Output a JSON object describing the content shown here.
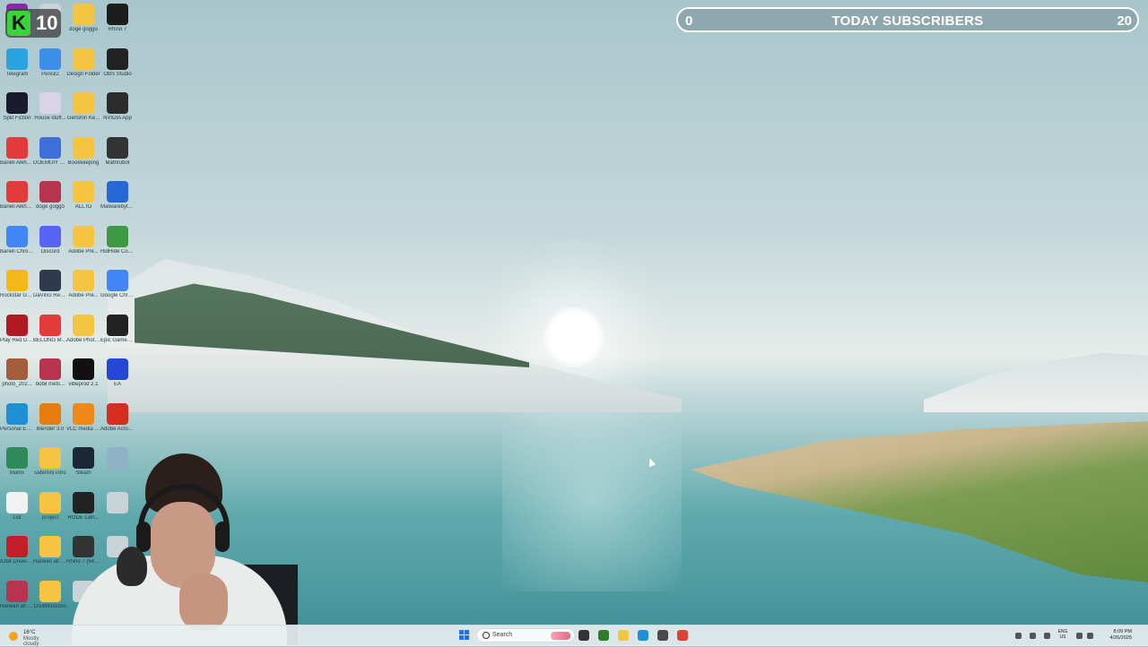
{
  "subscriber_counter": {
    "low": "0",
    "title": "TODAY SUBSCRIBERS",
    "high": "20"
  },
  "overlay_badge": {
    "letter": "K",
    "number": "10"
  },
  "desktop_icons": [
    {
      "label": "",
      "color": "#8b2aa6"
    },
    {
      "label": "",
      "color": "#c9d2d6"
    },
    {
      "label": "doge goggo",
      "color": "#f5c542"
    },
    {
      "label": "Rhino 7",
      "color": "#1d1d1d"
    },
    {
      "label": "Telegram",
      "color": "#2aa3df"
    },
    {
      "label": "Pencil2",
      "color": "#3c8ee8"
    },
    {
      "label": "Design Folder",
      "color": "#f5c542"
    },
    {
      "label": "OBS Studio",
      "color": "#222222"
    },
    {
      "label": "Split Fiction",
      "color": "#1b1b2e"
    },
    {
      "label": "House stuff...",
      "color": "#d9d3e8"
    },
    {
      "label": "Genshin Ke...",
      "color": "#f5c542"
    },
    {
      "label": "NVIDIA App",
      "color": "#2c2c2c"
    },
    {
      "label": "Baneli Alkhayri Bu...",
      "color": "#e33b3b"
    },
    {
      "label": "DOEMUIY Manager",
      "color": "#3e6fd8"
    },
    {
      "label": "Bookkeeping",
      "color": "#f5c542"
    },
    {
      "label": "Mathrubot",
      "color": "#333333"
    },
    {
      "label": "Baneli Alkhayri_Bu...",
      "color": "#e33b3b"
    },
    {
      "label": "doge goggo",
      "color": "#b8334d"
    },
    {
      "label": "ALL IO",
      "color": "#f5c542"
    },
    {
      "label": "Malwarebyt... Windows F...",
      "color": "#2567d4"
    },
    {
      "label": "Baneli Chrome",
      "color": "#4285f4"
    },
    {
      "label": "Discord",
      "color": "#5865f2"
    },
    {
      "label": "Adobe Pre...",
      "color": "#f5c542"
    },
    {
      "label": "HidHide Configurat...",
      "color": "#3d9a43"
    },
    {
      "label": "Rockstar Games ...",
      "color": "#f5b71c"
    },
    {
      "label": "DaVinci Resolve",
      "color": "#2f3b4c"
    },
    {
      "label": "Adobe Pre...",
      "color": "#f5c542"
    },
    {
      "label": "Google Chrome",
      "color": "#4285f4"
    },
    {
      "label": "Play Red Dead Rede...",
      "color": "#b01a22"
    },
    {
      "label": "BELONG M Alkhayri Bu...",
      "color": "#e33b3b"
    },
    {
      "label": "Adobe Photo...",
      "color": "#f5c542"
    },
    {
      "label": "Epic Games Launcher",
      "color": "#222222"
    },
    {
      "label": "photo_202...",
      "color": "#a35d3a"
    },
    {
      "label": "bobil mets...",
      "color": "#b8334d"
    },
    {
      "label": "vibeprod 2.1",
      "color": "#111111"
    },
    {
      "label": "EA",
      "color": "#2447d4"
    },
    {
      "label": "Personal Edge",
      "color": "#1e8fd1"
    },
    {
      "label": "Blender 3.0",
      "color": "#e87d0d"
    },
    {
      "label": "VLC media player",
      "color": "#ef8a1a"
    },
    {
      "label": "Adobe Acrobat",
      "color": "#d62d20"
    },
    {
      "label": "Matrix",
      "color": "#2e8b57"
    },
    {
      "label": "sabimini intro",
      "color": "#f5c542"
    },
    {
      "label": "Steam",
      "color": "#1b2838"
    },
    {
      "label": "",
      "color": "#8fb3c4"
    },
    {
      "label": "List",
      "color": "#f1f1f1"
    },
    {
      "label": "project",
      "color": "#f5c542"
    },
    {
      "label": "RODE Cen...",
      "color": "#222222"
    },
    {
      "label": "",
      "color": "#c9d2d6"
    },
    {
      "label": "IObit Driver Booster",
      "color": "#c41e2a"
    },
    {
      "label": "Haneen all designs ...",
      "color": "#f5c542"
    },
    {
      "label": "Rhino 7 (64-bit)",
      "color": "#333333"
    },
    {
      "label": "",
      "color": "#c9d2d6"
    },
    {
      "label": "Haneen all designs ...",
      "color": "#b8334d"
    },
    {
      "label": "DS4Windows",
      "color": "#f5c542"
    },
    {
      "label": "",
      "color": "#c9d2d6"
    },
    {
      "label": "",
      "color": "#c9d2d6"
    }
  ],
  "taskbar": {
    "weather_temp": "16°C",
    "weather_desc": "Mostly cloudy",
    "search_placeholder": "Search",
    "apps": [
      {
        "name": "task-view",
        "color": "#333333"
      },
      {
        "name": "xbox",
        "color": "#2d7d2d"
      },
      {
        "name": "file-explorer",
        "color": "#f5c542"
      },
      {
        "name": "edge",
        "color": "#1e8fd1"
      },
      {
        "name": "calculator",
        "color": "#4a4a4a"
      },
      {
        "name": "chrome",
        "color": "#db4437"
      }
    ],
    "language_top": "ENG",
    "language_bottom": "US",
    "time": "8:09 PM",
    "date": "4/26/2025"
  }
}
